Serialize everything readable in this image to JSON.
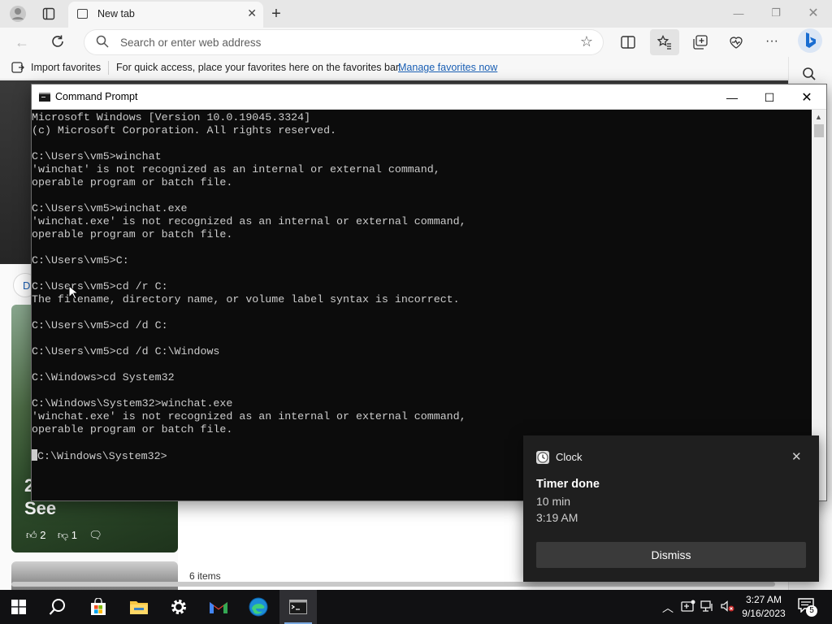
{
  "browser": {
    "tab": {
      "title": "New tab"
    },
    "address": {
      "placeholder": "Search or enter web address"
    },
    "favorites_bar": {
      "import_label": "Import favorites",
      "hint": "For quick access, place your favorites here on the favorites bar.",
      "manage_link": "Manage favorites now"
    }
  },
  "page": {
    "left_pill_text": "D",
    "card": {
      "number": "2",
      "headline": "See",
      "likes": "2",
      "dislikes": "1"
    },
    "items_count": "6 items"
  },
  "cmd": {
    "title": "Command Prompt",
    "lines": [
      "Microsoft Windows [Version 10.0.19045.3324]",
      "(c) Microsoft Corporation. All rights reserved.",
      "",
      "C:\\Users\\vm5>winchat",
      "'winchat' is not recognized as an internal or external command,",
      "operable program or batch file.",
      "",
      "C:\\Users\\vm5>winchat.exe",
      "'winchat.exe' is not recognized as an internal or external command,",
      "operable program or batch file.",
      "",
      "C:\\Users\\vm5>C:",
      "",
      "C:\\Users\\vm5>cd /r C:",
      "The filename, directory name, or volume label syntax is incorrect.",
      "",
      "C:\\Users\\vm5>cd /d C:",
      "",
      "C:\\Users\\vm5>cd /d C:\\Windows",
      "",
      "C:\\Windows>cd System32",
      "",
      "C:\\Windows\\System32>winchat.exe",
      "'winchat.exe' is not recognized as an internal or external command,",
      "operable program or batch file.",
      "",
      "C:\\Windows\\System32>"
    ]
  },
  "toast": {
    "app": "Clock",
    "title": "Timer done",
    "line1": "10 min",
    "line2": "3:19 AM",
    "button": "Dismiss"
  },
  "taskbar": {
    "time": "3:27 AM",
    "date": "9/16/2023",
    "notification_count": "5"
  },
  "colors": {
    "cmd_background": "#0c0c0c",
    "cmd_text": "#cccccc",
    "toast_background": "#1f1f1f",
    "taskbar": "#111113",
    "link": "#1a5fb4"
  }
}
